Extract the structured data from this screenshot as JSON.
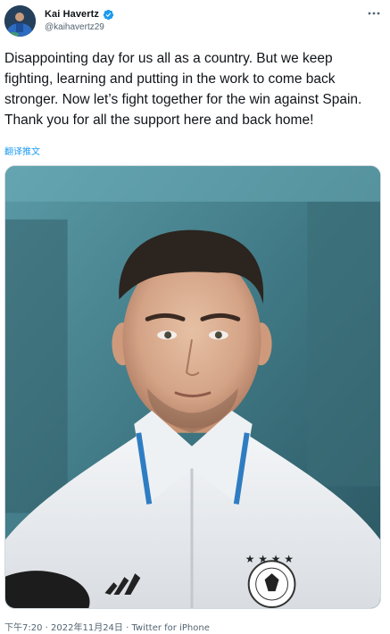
{
  "tweet": {
    "author": {
      "display_name": "Kai Havertz",
      "handle": "@kaihavertz29",
      "verified": true
    },
    "text": "Disappointing day for us all as a country. But we keep fighting, learning and putting in the work to come back stronger. Now let’s fight together for the win against Spain. Thank you for all the support here and back home!",
    "translate_label": "翻译推文",
    "meta": {
      "time": "下午7:20",
      "separator_1": " · ",
      "date": "2022年11月24日",
      "separator_2": " · ",
      "source": "Twitter for iPhone"
    }
  },
  "colors": {
    "text": "#0f1419",
    "secondary": "#536471",
    "link": "#1d9bf0",
    "verified": "#1d9bf0",
    "media_border": "#cfd9de"
  },
  "icons": {
    "verified": "verified-badge-icon",
    "more": "more-horizontal-icon"
  }
}
